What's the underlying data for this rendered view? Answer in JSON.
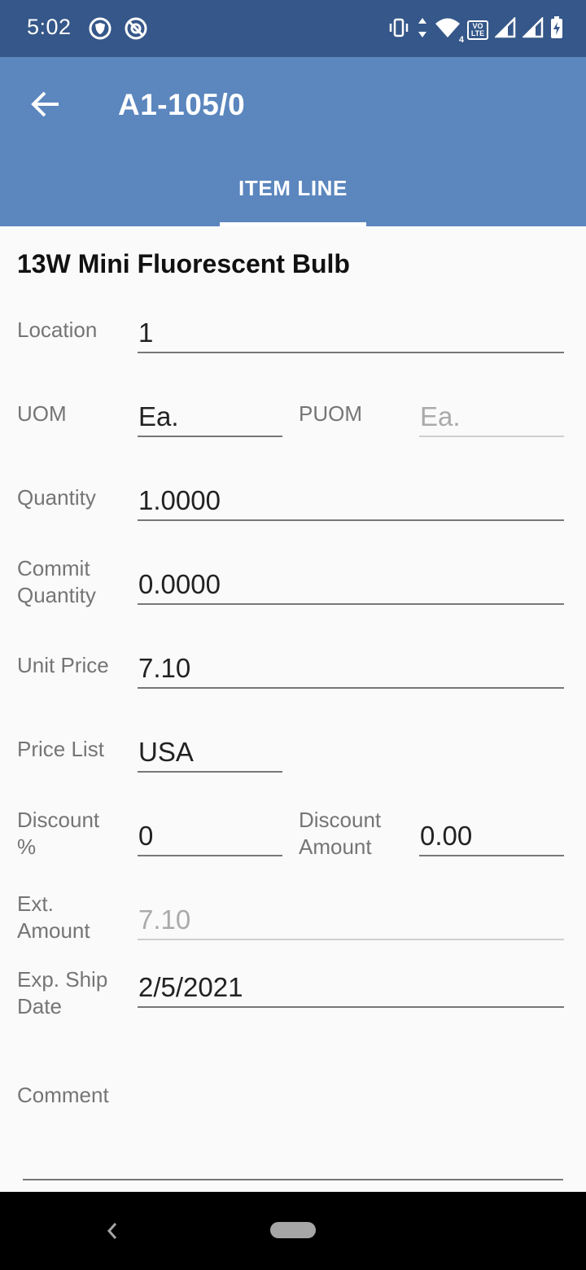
{
  "status_bar": {
    "time": "5:02",
    "left_icons": [
      "shield-icon",
      "no-sync-icon"
    ],
    "right_icons": [
      "vibrate-icon",
      "data-arrows-icon",
      "wifi-icon",
      "volte-icon",
      "signal-icon",
      "signal-icon",
      "battery-charging-icon"
    ],
    "volte_label_top": "VO",
    "volte_label_bottom": "LTE",
    "wifi_badge": "4"
  },
  "app_bar": {
    "title": "A1-105/0",
    "tab_label": "ITEM LINE"
  },
  "item": {
    "title": "13W Mini Fluorescent Bulb"
  },
  "fields": {
    "location": {
      "label": "Location",
      "value": "1"
    },
    "uom": {
      "label": "UOM",
      "value": "Ea."
    },
    "puom": {
      "label": "PUOM",
      "value": "Ea."
    },
    "quantity": {
      "label": "Quantity",
      "value": "1.0000"
    },
    "commit_quantity": {
      "label_line1": "Commit",
      "label_line2": "Quantity",
      "value": "0.0000"
    },
    "unit_price": {
      "label": "Unit Price",
      "value": "7.10"
    },
    "price_list": {
      "label": "Price List",
      "value": "USA"
    },
    "discount_pct": {
      "label_line1": "Discount",
      "label_line2": "%",
      "value": "0"
    },
    "discount_amount": {
      "label_line1": "Discount",
      "label_line2": "Amount",
      "value": "0.00"
    },
    "ext_amount": {
      "label_line1": "Ext.",
      "label_line2": "Amount",
      "value": "7.10"
    },
    "exp_ship_date": {
      "label_line1": "Exp. Ship",
      "label_line2": "Date",
      "value": "2/5/2021"
    },
    "comment": {
      "label": "Comment",
      "value": ""
    }
  },
  "colors": {
    "status_bar": "#355789",
    "app_bar": "#5b86be",
    "background": "#fafafa",
    "label": "#757575"
  }
}
